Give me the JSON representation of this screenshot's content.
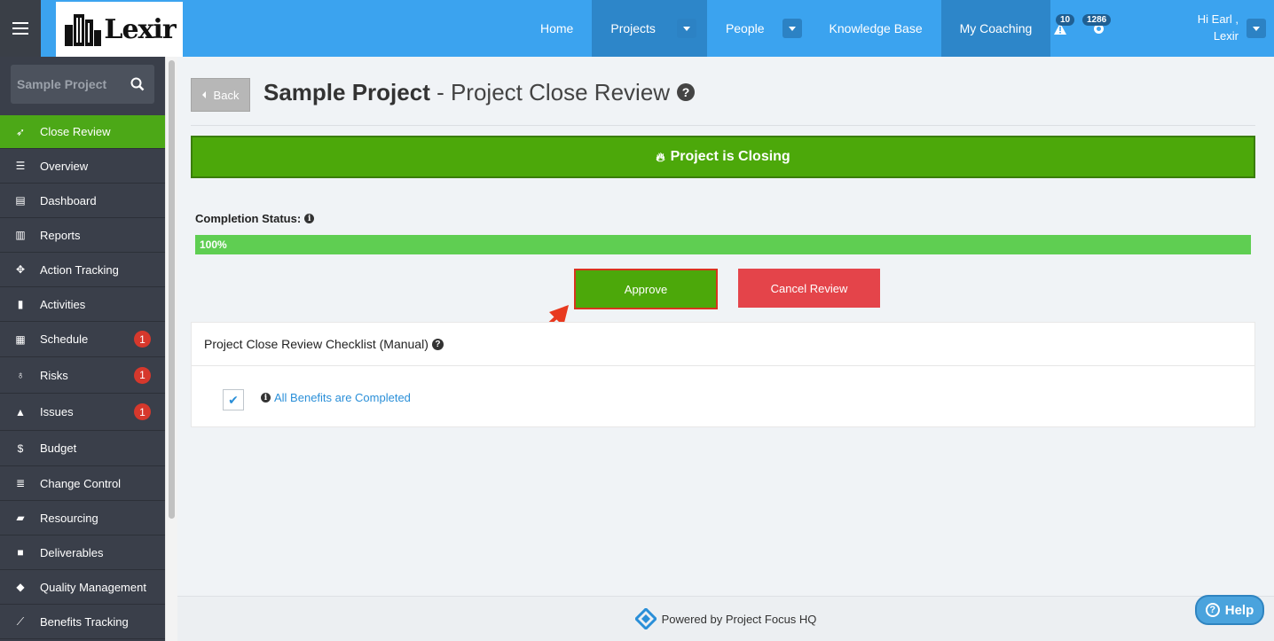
{
  "app": {
    "logo_text": "Lexir"
  },
  "nav": {
    "items": [
      {
        "label": "Home"
      },
      {
        "label": "Projects"
      },
      {
        "label": "People"
      },
      {
        "label": "Knowledge Base"
      },
      {
        "label": "My Coaching"
      }
    ],
    "alerts_count": "10",
    "updates_count": "1286",
    "greeting_line1": "Hi Earl ,",
    "greeting_line2": "Lexir"
  },
  "sidebar": {
    "search_value": "Sample Project",
    "items": [
      {
        "label": "Close Review",
        "icon": "rocket-icon"
      },
      {
        "label": "Overview",
        "icon": "align-left-icon"
      },
      {
        "label": "Dashboard",
        "icon": "dashboard-icon"
      },
      {
        "label": "Reports",
        "icon": "bar-chart-icon"
      },
      {
        "label": "Action Tracking",
        "icon": "crosshair-icon"
      },
      {
        "label": "Activities",
        "icon": "bookmark-icon"
      },
      {
        "label": "Schedule",
        "icon": "calendar-icon",
        "badge": "1"
      },
      {
        "label": "Risks",
        "icon": "lightbulb-icon",
        "badge": "1"
      },
      {
        "label": "Issues",
        "icon": "warning-icon",
        "badge": "1"
      },
      {
        "label": "Budget",
        "icon": "dollar-icon"
      },
      {
        "label": "Change Control",
        "icon": "list-icon"
      },
      {
        "label": "Resourcing",
        "icon": "folder-open-icon"
      },
      {
        "label": "Deliverables",
        "icon": "truck-icon"
      },
      {
        "label": "Quality Management",
        "icon": "tag-icon"
      },
      {
        "label": "Benefits Tracking",
        "icon": "line-chart-icon"
      }
    ]
  },
  "page": {
    "back_label": "Back",
    "title_project": "Sample Project",
    "title_rest": " - Project Close Review",
    "banner": "Project is Closing",
    "completion_label": "Completion Status:",
    "progress_text": "100%",
    "progress_value": 1.0,
    "approve_label": "Approve",
    "cancel_label": "Cancel Review"
  },
  "checklist": {
    "title": "Project Close Review Checklist (Manual)",
    "items": [
      {
        "label": "All Benefits are Completed",
        "checked": true
      }
    ]
  },
  "footer": {
    "text": "Powered by Project Focus HQ",
    "help_label": "Help"
  },
  "colors": {
    "topbar": "#3ba3ef",
    "sidebar": "#3a3f4a",
    "active_green": "#4ca817",
    "danger_red": "#e4444a",
    "progress_green": "#5fce52"
  }
}
